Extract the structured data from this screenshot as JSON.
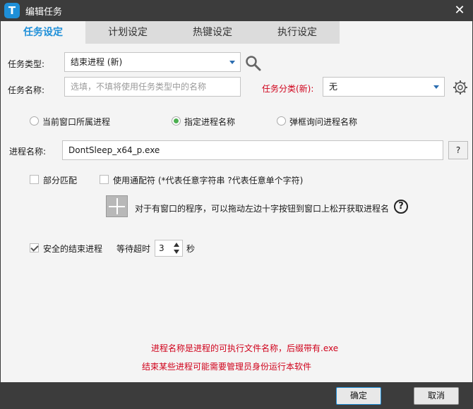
{
  "window": {
    "title": "编辑任务",
    "app_icon_letter": "T"
  },
  "tabs": [
    {
      "label": "任务设定",
      "active": true
    },
    {
      "label": "计划设定",
      "active": false
    },
    {
      "label": "热键设定",
      "active": false
    },
    {
      "label": "执行设定",
      "active": false
    }
  ],
  "form": {
    "task_type_label": "任务类型:",
    "task_type_value": "结束进程 (新)",
    "task_name_label": "任务名称:",
    "task_name_placeholder": "选填，不填将使用任务类型中的名称",
    "category_label": "任务分类(新):",
    "category_value": "无",
    "radio_options": [
      {
        "label": "当前窗口所属进程",
        "selected": false
      },
      {
        "label": "指定进程名称",
        "selected": true
      },
      {
        "label": "弹框询问进程名称",
        "selected": false
      }
    ],
    "process_name_label": "进程名称:",
    "process_name_value": "DontSleep_x64_p.exe",
    "help_button_label": "?",
    "partial_match_label": "部分匹配",
    "partial_match_checked": false,
    "wildcard_label": "使用通配符 (*代表任意字符串 ?代表任意单个字符)",
    "wildcard_checked": false,
    "drag_hint": "对于有窗口的程序，可以拖动左边十字按钮到窗口上松开获取进程名",
    "drag_help_glyph": "?",
    "safe_kill_label": "安全的结束进程",
    "safe_kill_checked": true,
    "timeout_label": "等待超时",
    "timeout_value": "3",
    "timeout_unit": "秒"
  },
  "notes": [
    "进程名称是进程的可执行文件名称，后缀带有.exe",
    "结束某些进程可能需要管理员身份运行本软件"
  ],
  "buttons": {
    "ok": "确定",
    "cancel": "取消"
  },
  "colors": {
    "accent": "#1e8fd8",
    "warning": "#d0021b",
    "chrome": "#3c3c3c"
  }
}
